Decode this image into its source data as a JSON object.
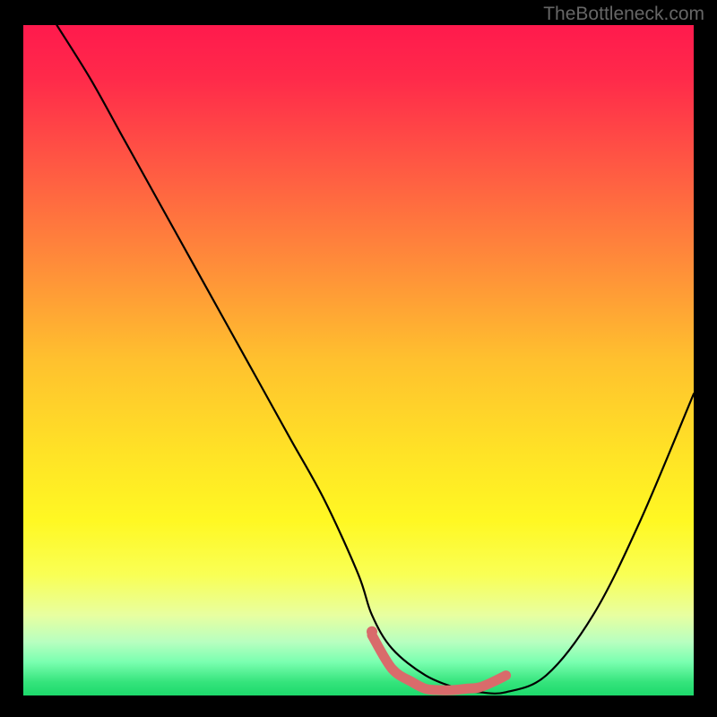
{
  "watermark": "TheBottleneck.com",
  "chart_data": {
    "type": "line",
    "title": "",
    "xlabel": "",
    "ylabel": "",
    "xlim": [
      0,
      100
    ],
    "ylim": [
      0,
      100
    ],
    "series": [
      {
        "name": "curve-black",
        "x": [
          5,
          10,
          15,
          20,
          25,
          30,
          35,
          40,
          45,
          50,
          52,
          55,
          60,
          65,
          68,
          72,
          78,
          85,
          92,
          100
        ],
        "y": [
          100,
          92,
          83,
          74,
          65,
          56,
          47,
          38,
          29,
          18,
          12,
          7,
          3,
          1,
          0.5,
          0.5,
          3,
          12,
          26,
          45
        ]
      },
      {
        "name": "optimal-band-pink",
        "x": [
          52,
          55,
          58,
          60,
          62,
          64,
          66,
          68,
          70,
          72
        ],
        "y": [
          9,
          4,
          2,
          1,
          0.8,
          0.8,
          1,
          1.2,
          2,
          3
        ]
      }
    ],
    "annotations": [],
    "grid": false,
    "legend": false
  }
}
